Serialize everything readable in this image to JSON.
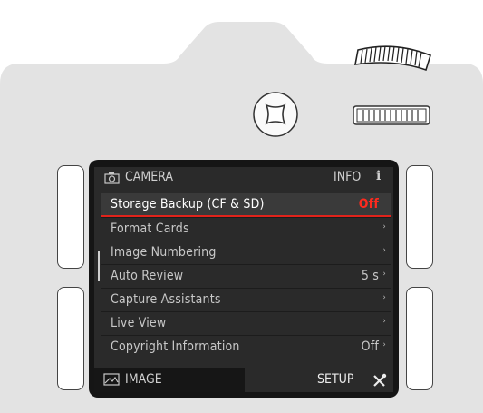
{
  "screen": {
    "header": {
      "title": "CAMERA",
      "info_label": "INFO",
      "info_icon": "i",
      "camera_icon": "camera-icon"
    },
    "menu_items": [
      {
        "label": "Storage Backup (CF & SD)",
        "value": "Off",
        "arrow": "",
        "selected": true
      },
      {
        "label": "Format Cards",
        "value": "",
        "arrow": "›"
      },
      {
        "label": "Image Numbering",
        "value": "",
        "arrow": "›"
      },
      {
        "label": "Auto Review",
        "value": "5 s",
        "arrow": "›"
      },
      {
        "label": "Capture Assistants",
        "value": "",
        "arrow": "›"
      },
      {
        "label": "Live View",
        "value": "",
        "arrow": "›"
      },
      {
        "label": "Copyright Information",
        "value": "Off",
        "arrow": "›"
      }
    ],
    "footer": {
      "left_label": "IMAGE",
      "right_label": "SETUP",
      "left_icon": "image-icon",
      "right_icon": "tools-icon"
    }
  },
  "colors": {
    "accent": "#ff2a1e",
    "screen_bg": "#2a2a2a",
    "body": "#e3e3e3"
  }
}
